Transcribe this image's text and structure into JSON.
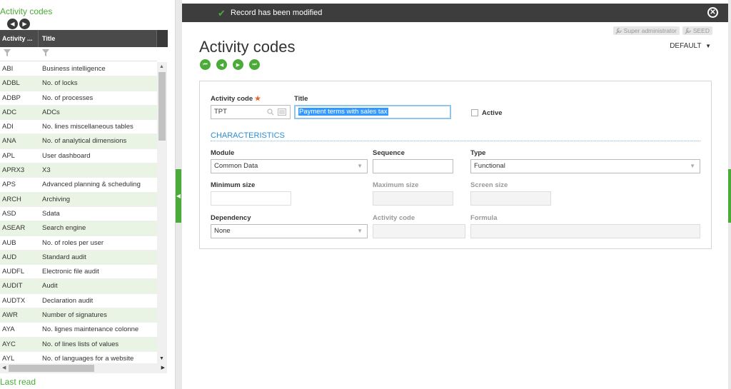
{
  "left_panel": {
    "title": "Activity codes",
    "columns": [
      "Activity ...",
      "Title"
    ],
    "rows": [
      {
        "code": "ABI",
        "title": "Business intelligence"
      },
      {
        "code": "ADBL",
        "title": "No. of locks"
      },
      {
        "code": "ADBP",
        "title": "No. of processes"
      },
      {
        "code": "ADC",
        "title": "ADCs"
      },
      {
        "code": "ADI",
        "title": "No. lines miscellaneous tables"
      },
      {
        "code": "ANA",
        "title": "No. of analytical dimensions"
      },
      {
        "code": "APL",
        "title": "User dashboard"
      },
      {
        "code": "APRX3",
        "title": "X3"
      },
      {
        "code": "APS",
        "title": "Advanced planning & scheduling"
      },
      {
        "code": "ARCH",
        "title": "Archiving"
      },
      {
        "code": "ASD",
        "title": "Sdata"
      },
      {
        "code": "ASEAR",
        "title": "Search engine"
      },
      {
        "code": "AUB",
        "title": "No. of roles per user"
      },
      {
        "code": "AUD",
        "title": "Standard audit"
      },
      {
        "code": "AUDFL",
        "title": "Electronic file audit"
      },
      {
        "code": "AUDIT",
        "title": "Audit"
      },
      {
        "code": "AUDTX",
        "title": "Declaration audit"
      },
      {
        "code": "AWR",
        "title": "Number of signatures"
      },
      {
        "code": "AYA",
        "title": "No. lignes maintenance colonne"
      },
      {
        "code": "AYC",
        "title": "No. of lines lists of values"
      },
      {
        "code": "AYL",
        "title": "No. of languages for a website"
      }
    ],
    "footer": "Last read"
  },
  "message_bar": {
    "text": "Record has been modified"
  },
  "user": {
    "role": "Super administrator",
    "folder": "SEED"
  },
  "main": {
    "title": "Activity codes",
    "view_selector": "DEFAULT",
    "form": {
      "activity_code_label": "Activity code",
      "required_mark": "★",
      "activity_code_value": "TPT",
      "title_label": "Title",
      "title_value": "Payment terms with sales tax",
      "active_label": "Active",
      "section": "CHARACTERISTICS",
      "module_label": "Module",
      "module_value": "Common Data",
      "sequence_label": "Sequence",
      "sequence_value": "",
      "type_label": "Type",
      "type_value": "Functional",
      "minimum_size_label": "Minimum size",
      "minimum_size_value": "",
      "maximum_size_label": "Maximum size",
      "screen_size_label": "Screen size",
      "dependency_label": "Dependency",
      "dependency_value": "None",
      "dep_activity_code_label": "Activity code",
      "formula_label": "Formula"
    }
  },
  "colors": {
    "accent_green": "#4bab38",
    "section_blue": "#2b8ed1",
    "dark_bar": "#3d3d3d"
  }
}
